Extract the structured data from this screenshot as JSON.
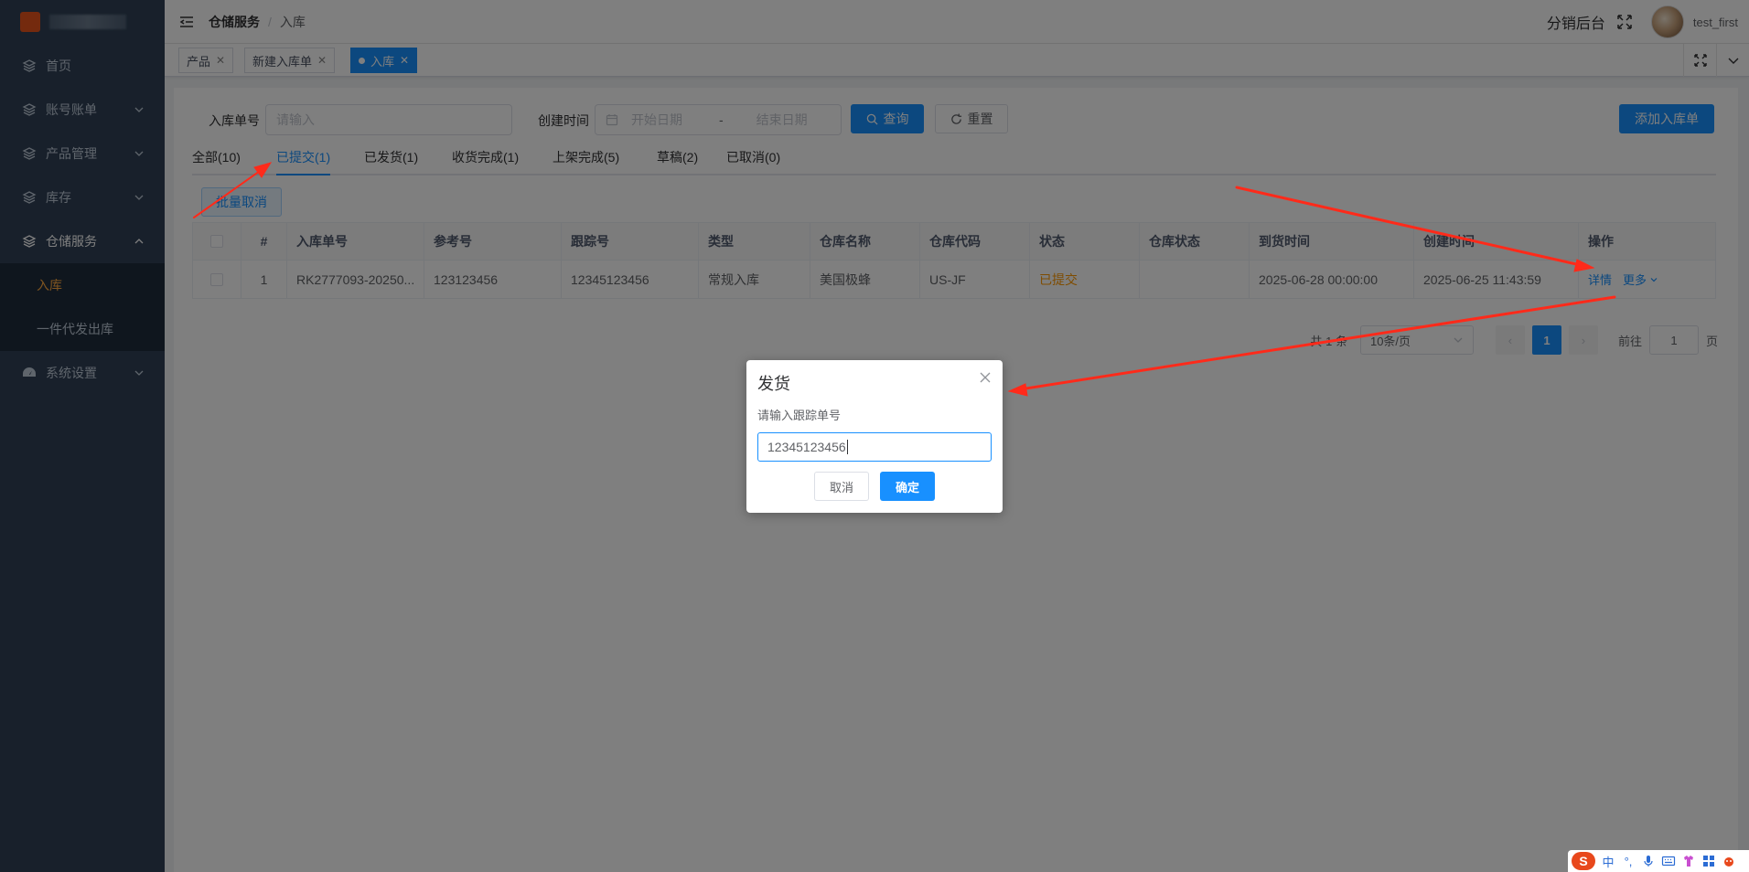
{
  "sidebar": {
    "items": [
      {
        "label": "首页",
        "icon": "layers-icon",
        "expandable": false
      },
      {
        "label": "账号账单",
        "icon": "layers-icon",
        "expandable": true
      },
      {
        "label": "产品管理",
        "icon": "layers-icon",
        "expandable": true
      },
      {
        "label": "库存",
        "icon": "layers-icon",
        "expandable": true
      },
      {
        "label": "仓储服务",
        "icon": "layers-icon",
        "expandable": true,
        "open": true
      },
      {
        "label": "系统设置",
        "icon": "dashboard-icon",
        "expandable": true
      }
    ],
    "sub_items": [
      {
        "label": "入库",
        "active": true
      },
      {
        "label": "一件代发出库",
        "active": false
      }
    ]
  },
  "header": {
    "breadcrumb": [
      "仓储服务",
      "入库"
    ],
    "platform": "分销后台",
    "username": "test_first"
  },
  "tags": [
    {
      "label": "产品",
      "active": false
    },
    {
      "label": "新建入库单",
      "active": false
    },
    {
      "label": "入库",
      "active": true
    }
  ],
  "filter": {
    "order_no_label": "入库单号",
    "order_no_placeholder": "请输入",
    "created_label": "创建时间",
    "start_placeholder": "开始日期",
    "date_sep": "-",
    "end_placeholder": "结束日期",
    "search_label": "查询",
    "reset_label": "重置",
    "add_label": "添加入库单"
  },
  "tabs": [
    {
      "label": "全部(10)",
      "active": false
    },
    {
      "label": "已提交(1)",
      "active": true
    },
    {
      "label": "已发货(1)",
      "active": false
    },
    {
      "label": "收货完成(1)",
      "active": false
    },
    {
      "label": "上架完成(5)",
      "active": false
    },
    {
      "label": "草稿(2)",
      "active": false
    },
    {
      "label": "已取消(0)",
      "active": false
    }
  ],
  "batch_cancel_label": "批量取消",
  "table": {
    "columns": [
      "#",
      "入库单号",
      "参考号",
      "跟踪号",
      "类型",
      "仓库名称",
      "仓库代码",
      "状态",
      "仓库状态",
      "到货时间",
      "创建时间",
      "操作"
    ],
    "rows": [
      {
        "index": "1",
        "order_no": "RK2777093-20250...",
        "ref_no": "123123456",
        "tracking_no": "12345123456",
        "type": "常规入库",
        "warehouse_name": "美国极蜂",
        "warehouse_code": "US-JF",
        "status": "已提交",
        "warehouse_status": "",
        "arrival_time": "2025-06-28 00:00:00",
        "created_time": "2025-06-25 11:43:59",
        "op_detail": "详情",
        "op_more": "更多"
      }
    ]
  },
  "pagination": {
    "total": "共 1 条",
    "page_size": "10条/页",
    "current": "1",
    "prev": "‹",
    "next": "›",
    "goto_label": "前往",
    "goto_value": "1",
    "page_suffix": "页"
  },
  "dialog": {
    "title": "发货",
    "message": "请输入跟踪单号",
    "input_value": "12345123456",
    "cancel_label": "取消",
    "confirm_label": "确定"
  },
  "ime": {
    "logo": "S",
    "lang": "中",
    "punct": "°,"
  },
  "colors": {
    "primary": "#1890ff",
    "sidebar_bg": "#304156",
    "status_submitted": "#ff9900",
    "annotation": "#ff2a1a"
  }
}
